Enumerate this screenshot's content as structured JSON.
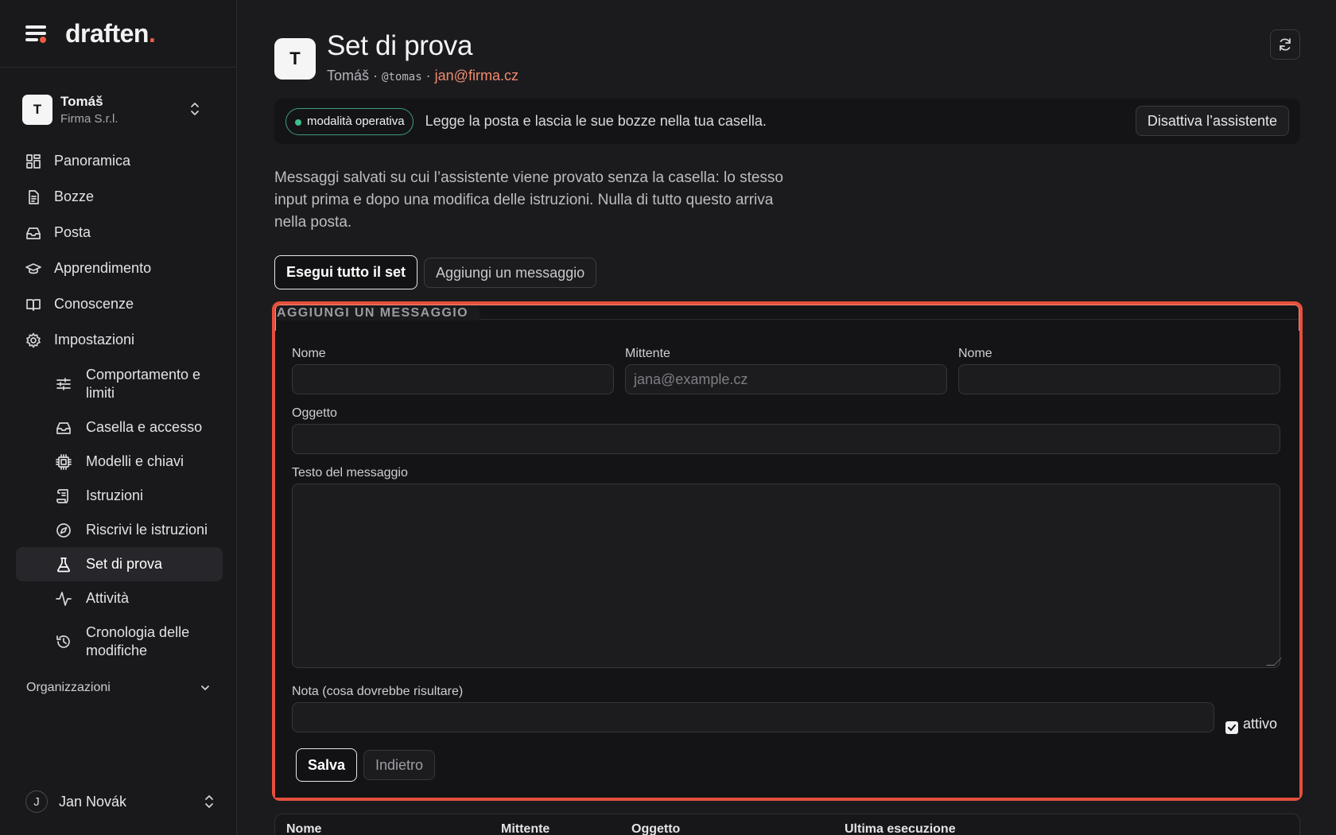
{
  "brand": {
    "logo_text": "draften",
    "logo_dot": ".",
    "accent_color": "#ef5b3f"
  },
  "account": {
    "initial": "T",
    "name": "Tomáš",
    "company": "Firma S.r.l."
  },
  "nav": {
    "items": [
      {
        "label": "Panoramica",
        "icon": "dashboard-icon"
      },
      {
        "label": "Bozze",
        "icon": "document-icon"
      },
      {
        "label": "Posta",
        "icon": "inbox-icon"
      },
      {
        "label": "Apprendimento",
        "icon": "graduation-cap-icon"
      },
      {
        "label": "Conoscenze",
        "icon": "book-icon"
      },
      {
        "label": "Impostazioni",
        "icon": "gear-icon"
      }
    ],
    "sub_items": [
      {
        "label": "Comportamento e limiti",
        "icon": "sliders-icon"
      },
      {
        "label": "Casella e accesso",
        "icon": "inbox-icon"
      },
      {
        "label": "Modelli e chiavi",
        "icon": "chip-icon"
      },
      {
        "label": "Istruzioni",
        "icon": "scroll-icon"
      },
      {
        "label": "Riscrivi le istruzioni",
        "icon": "compass-icon"
      },
      {
        "label": "Set di prova",
        "icon": "flask-icon",
        "active": true
      },
      {
        "label": "Attività",
        "icon": "activity-icon"
      },
      {
        "label": "Cronologia delle modifiche",
        "icon": "history-icon"
      }
    ],
    "organizations_label": "Organizzazioni"
  },
  "user": {
    "initial": "J",
    "name": "Jan Novák"
  },
  "header": {
    "avatar_initial": "T",
    "title": "Set di prova",
    "owner_name": "Tomáš",
    "separator": "·",
    "handle": "@tomas",
    "email": "jan@firma.cz"
  },
  "status": {
    "badge": "modalità operativa",
    "badge_color": "#3fbf8b",
    "text": "Legge la posta e lascia le sue bozze nella tua casella.",
    "deactivate_label": "Disattiva l’assistente"
  },
  "description": "Messaggi salvati su cui l’assistente viene provato senza la casella: lo stesso input prima e dopo una modifica delle istruzioni. Nulla di tutto questo arriva nella posta.",
  "actions": {
    "run_all": "Esegui tutto il set",
    "add_message": "Aggiungi un messaggio"
  },
  "form": {
    "legend": "AGGIUNGI UN MESSAGGIO",
    "name_label": "Nome",
    "name_value": "",
    "sender_label": "Mittente",
    "sender_placeholder": "jana@example.cz",
    "name2_label": "Nome",
    "name2_value": "",
    "subject_label": "Oggetto",
    "subject_value": "",
    "body_label": "Testo del messaggio",
    "body_value": "",
    "note_label": "Nota (cosa dovrebbe risultare)",
    "note_value": "",
    "active_label": "attivo",
    "active_checked": true,
    "save_label": "Salva",
    "back_label": "Indietro",
    "highlight_color": "#e5503c"
  },
  "table": {
    "columns": [
      "Nome",
      "Mittente",
      "Oggetto",
      "Ultima esecuzione"
    ]
  }
}
